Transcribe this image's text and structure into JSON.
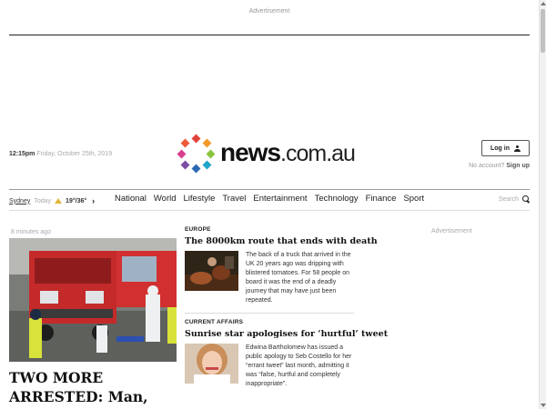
{
  "ad_top_label": "Advertisement",
  "header": {
    "time": "12:15pm",
    "date": "Friday, October 25th, 2019",
    "logo": {
      "name": "news",
      "suffix": ".com.au",
      "dot_colors": [
        "#e2423b",
        "#f39a2b",
        "#8ac43f",
        "#22a5c9",
        "#2a6ab3",
        "#7b4ea3",
        "#d93f8c",
        "#ef5a39"
      ]
    },
    "login_label": "Log in",
    "no_account_text": "No account?",
    "signup_label": "Sign up"
  },
  "weather": {
    "city": "Sydney",
    "day": "Today",
    "temp": "19°/36°",
    "icon": "sun-icon",
    "next_icon": "chevron-right-icon"
  },
  "nav": {
    "items": [
      "National",
      "World",
      "Lifestyle",
      "Travel",
      "Entertainment",
      "Technology",
      "Finance",
      "Sport"
    ]
  },
  "search": {
    "label": "Search"
  },
  "lead": {
    "time_ago": "8 minutes ago",
    "headline": "TWO MORE ARRESTED: Man, woman arrested"
  },
  "stories": [
    {
      "category": "EUROPE",
      "title": "The 8000km route that ends with death",
      "summary": "The back of a truck that arrived in the UK 20 years ago was dripping with blistered tomatoes. For 58 people on board it was the end of a deadly journey that may have just been repeated."
    },
    {
      "category": "CURRENT AFFAIRS",
      "title": "Sunrise star apologises for ‘hurtful’ tweet",
      "summary": "Edwina Bartholomew has issued a public apology to Seb Costello for her “errant tweet” last month, admitting it was “false, hurtful and completely inappropriate”."
    }
  ],
  "ad_right_label": "Advertisement"
}
